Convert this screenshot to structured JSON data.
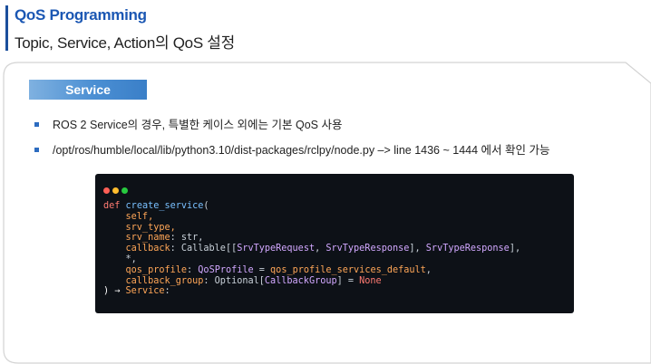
{
  "header": {
    "title": "QoS Programming",
    "subtitle": "Topic, Service, Action의 QoS 설정"
  },
  "section": {
    "label": "Service"
  },
  "bullets": [
    "ROS 2 Service의 경우, 특별한 케이스 외에는 기본 QoS 사용",
    "/opt/ros/humble/local/lib/python3.10/dist-packages/rclpy/node.py –> line 1436 ~ 1444 에서 확인 가능"
  ],
  "colors": {
    "accent": "#1b57b3",
    "dot_red": "#ff5f56",
    "dot_yellow": "#ffbd2e",
    "dot_green": "#27c93f"
  },
  "code": {
    "l1_kw": "def",
    "l1_fn": "create_service",
    "l1_rest": "(",
    "l2": "    self,",
    "l3": "    srv_type,",
    "l4_p": "    srv_name",
    "l4_r": ": str,",
    "l5_p": "    callback",
    "l5_a": ": Callable[[",
    "l5_t1": "SrvTypeRequest",
    "l5_b": ", ",
    "l5_t2": "SrvTypeResponse",
    "l5_c": "], ",
    "l5_t3": "SrvTypeResponse",
    "l5_d": "],",
    "l6": "    *,",
    "l7_p": "    qos_profile",
    "l7_a": ": ",
    "l7_t": "QoSProfile",
    "l7_b": " = ",
    "l7_v": "qos_profile_services_default",
    "l7_c": ",",
    "l8_p": "    callback_group",
    "l8_a": ": Optional[",
    "l8_t": "CallbackGroup",
    "l8_b": "] = ",
    "l8_kw": "None",
    "l9_a": ") → ",
    "l9_t": "Service",
    "l9_b": ":"
  }
}
